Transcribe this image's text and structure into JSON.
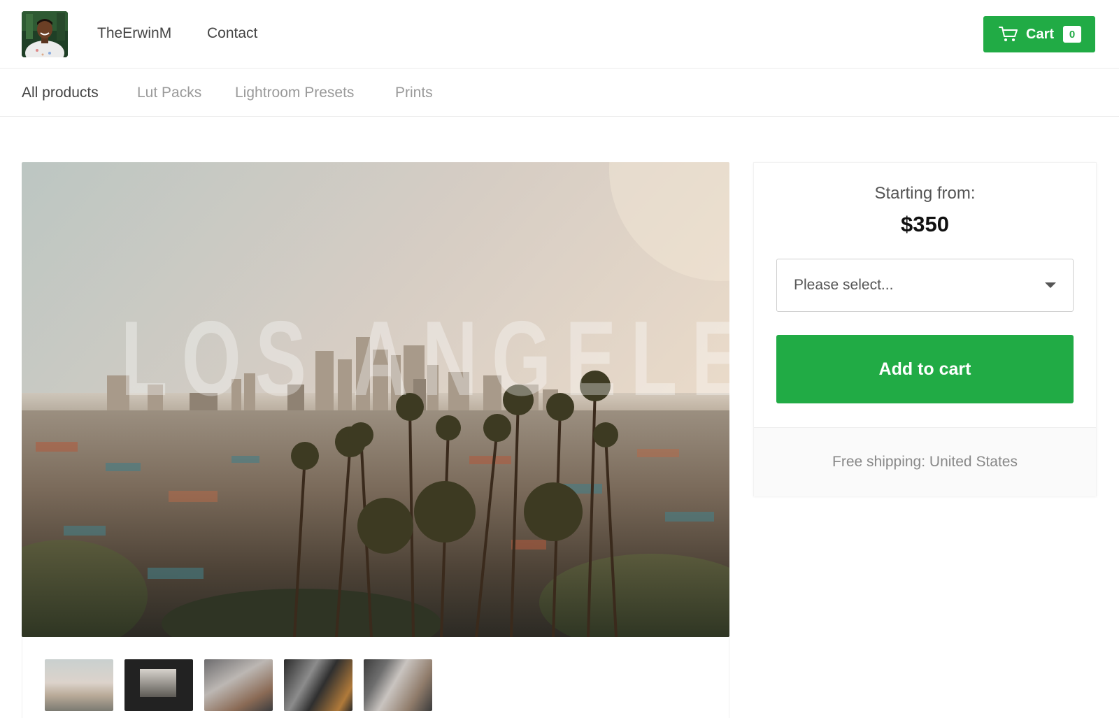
{
  "header": {
    "store_name": "TheErwinM",
    "contact_label": "Contact",
    "cart": {
      "label": "Cart",
      "count": "0"
    }
  },
  "categories": [
    {
      "label": "All products",
      "active": true
    },
    {
      "label": "Lut Packs",
      "active": false
    },
    {
      "label": "Lightroom Presets",
      "active": false
    },
    {
      "label": "Prints",
      "active": false
    }
  ],
  "product": {
    "image_caption": "LOS ANGELES",
    "thumbnail_count": 5
  },
  "purchase": {
    "starting_label": "Starting from:",
    "price": "$350",
    "select_placeholder": "Please select...",
    "add_to_cart_label": "Add to cart",
    "shipping_text": "Free shipping: United States"
  },
  "colors": {
    "accent": "#21ab45",
    "text": "#444444",
    "muted": "#9a9a9a"
  }
}
